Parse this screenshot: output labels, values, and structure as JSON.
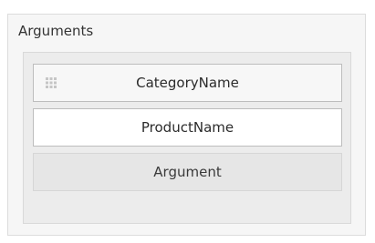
{
  "group": {
    "title": "Arguments"
  },
  "items": [
    {
      "label": "CategoryName",
      "has_grip": true
    },
    {
      "label": "ProductName"
    },
    {
      "label": "Argument",
      "is_placeholder": true
    }
  ],
  "icons": {
    "grip": "drag-grip-icon"
  },
  "colors": {
    "panel_bg": "#f6f6f6",
    "drop_area_bg": "#ececec",
    "item_border": "#bdbdbd",
    "placeholder_bg": "#e6e6e6"
  }
}
